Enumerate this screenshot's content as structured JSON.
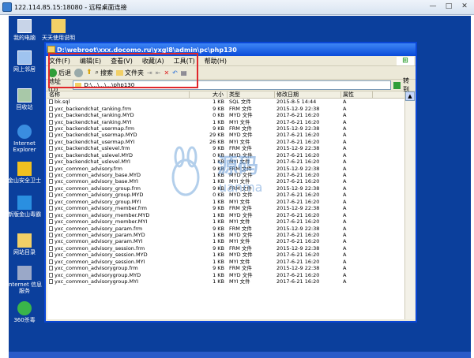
{
  "outer": {
    "title": "122.114.85.15:18080 - 远程桌面连接",
    "btn_min": "—",
    "btn_max": "□",
    "btn_close": "✕"
  },
  "desktop": {
    "icons": [
      {
        "label": "我的电脑",
        "icon": "computer-icon"
      },
      {
        "label": "网上邻居",
        "icon": "network-icon"
      },
      {
        "label": "回收站",
        "icon": "recycle-bin-icon"
      },
      {
        "label": "Internet Explorer",
        "icon": "ie-icon"
      },
      {
        "label": "金山安全卫士",
        "icon": "shield-app-icon"
      },
      {
        "label": "新版金山毒霸",
        "icon": "antivirus-icon"
      },
      {
        "label": "网站目录",
        "icon": "folder-icon"
      },
      {
        "label": "Internet 信息服务",
        "icon": "iis-icon"
      },
      {
        "label": "360杀毒",
        "icon": "antivirus2-icon"
      },
      {
        "label": "天天使用说明",
        "icon": "folder-icon"
      }
    ]
  },
  "explorer": {
    "title": "D:\\webroot\\xxx.docomo.ru\\yxgl8\\admin\\pc\\php130",
    "menu": [
      "文件(F)",
      "编辑(E)",
      "查看(V)",
      "收藏(A)",
      "工具(T)",
      "帮助(H)"
    ],
    "toolbar": {
      "back": "后退",
      "search": "搜索",
      "folders": "文件夹",
      "views": "查看"
    },
    "address": {
      "label": "地址(D)",
      "value": "D:\\...\\...\\...\\php130",
      "go": "转到"
    },
    "columns": [
      "名称",
      "大小",
      "类型",
      "修改日期",
      "属性"
    ]
  },
  "rows": [
    [
      "bk.sql",
      "1 KB",
      "SQL 文件",
      "2015-8-5 14:44",
      "A"
    ],
    [
      "yxc_backendchat_ranking.frm",
      "9 KB",
      "FRM 文件",
      "2015-12-9 22:38",
      "A"
    ],
    [
      "yxc_backendchat_ranking.MYD",
      "0 KB",
      "MYD 文件",
      "2017-6-21 16:20",
      "A"
    ],
    [
      "yxc_backendchat_ranking.MYI",
      "1 KB",
      "MYI 文件",
      "2017-6-21 16:20",
      "A"
    ],
    [
      "yxc_backendchat_usermap.frm",
      "9 KB",
      "FRM 文件",
      "2015-12-9 22:38",
      "A"
    ],
    [
      "yxc_backendchat_usermap.MYD",
      "29 KB",
      "MYD 文件",
      "2017-6-21 16:20",
      "A"
    ],
    [
      "yxc_backendchat_usermap.MYI",
      "26 KB",
      "MYI 文件",
      "2017-6-21 16:20",
      "A"
    ],
    [
      "yxc_backendchat_uslevel.frm",
      "9 KB",
      "FRM 文件",
      "2015-12-9 22:38",
      "A"
    ],
    [
      "yxc_backendchat_uslevel.MYD",
      "0 KB",
      "MYD 文件",
      "2017-6-21 16:20",
      "A"
    ],
    [
      "yxc_backendchat_uslevel.MYI",
      "1 KB",
      "MYI 文件",
      "2017-6-21 16:20",
      "A"
    ],
    [
      "yxc_common_advisory.frm",
      "9 KB",
      "FRM 文件",
      "2015-12-9 22:38",
      "A"
    ],
    [
      "yxc_common_advisory_base.MYD",
      "1 KB",
      "MYD 文件",
      "2017-6-21 16:20",
      "A"
    ],
    [
      "yxc_common_advisory_base.MYI",
      "1 KB",
      "MYI 文件",
      "2017-6-21 16:20",
      "A"
    ],
    [
      "yxc_common_advisory_group.frm",
      "9 KB",
      "FRM 文件",
      "2015-12-9 22:38",
      "A"
    ],
    [
      "yxc_common_advisory_group.MYD",
      "0 KB",
      "MYD 文件",
      "2017-6-21 16:20",
      "A"
    ],
    [
      "yxc_common_advisory_group.MYI",
      "1 KB",
      "MYI 文件",
      "2017-6-21 16:20",
      "A"
    ],
    [
      "yxc_common_advisory_member.frm",
      "9 KB",
      "FRM 文件",
      "2015-12-9 22:38",
      "A"
    ],
    [
      "yxc_common_advisory_member.MYD",
      "1 KB",
      "MYD 文件",
      "2017-6-21 16:20",
      "A"
    ],
    [
      "yxc_common_advisory_member.MYI",
      "1 KB",
      "MYI 文件",
      "2017-6-21 16:20",
      "A"
    ],
    [
      "yxc_common_advisory_param.frm",
      "9 KB",
      "FRM 文件",
      "2015-12-9 22:38",
      "A"
    ],
    [
      "yxc_common_advisory_param.MYD",
      "1 KB",
      "MYD 文件",
      "2017-6-21 16:20",
      "A"
    ],
    [
      "yxc_common_advisory_param.MYI",
      "1 KB",
      "MYI 文件",
      "2017-6-21 16:20",
      "A"
    ],
    [
      "yxc_common_advisory_session.frm",
      "9 KB",
      "FRM 文件",
      "2015-12-9 22:38",
      "A"
    ],
    [
      "yxc_common_advisory_session.MYD",
      "1 KB",
      "MYD 文件",
      "2017-6-21 16:20",
      "A"
    ],
    [
      "yxc_common_advisory_session.MYI",
      "1 KB",
      "MYI 文件",
      "2017-6-21 16:20",
      "A"
    ],
    [
      "yxc_common_advisorygroup.frm",
      "9 KB",
      "FRM 文件",
      "2015-12-9 22:38",
      "A"
    ],
    [
      "yxc_common_advisorygroup.MYD",
      "1 KB",
      "MYD 文件",
      "2017-6-21 16:20",
      "A"
    ],
    [
      "yxc_common_advisorygroup.MYI",
      "1 KB",
      "MYI 文件",
      "2017-6-21 16:20",
      "A"
    ]
  ],
  "watermark": {
    "line1": "源码",
    "line2": "uanma"
  }
}
